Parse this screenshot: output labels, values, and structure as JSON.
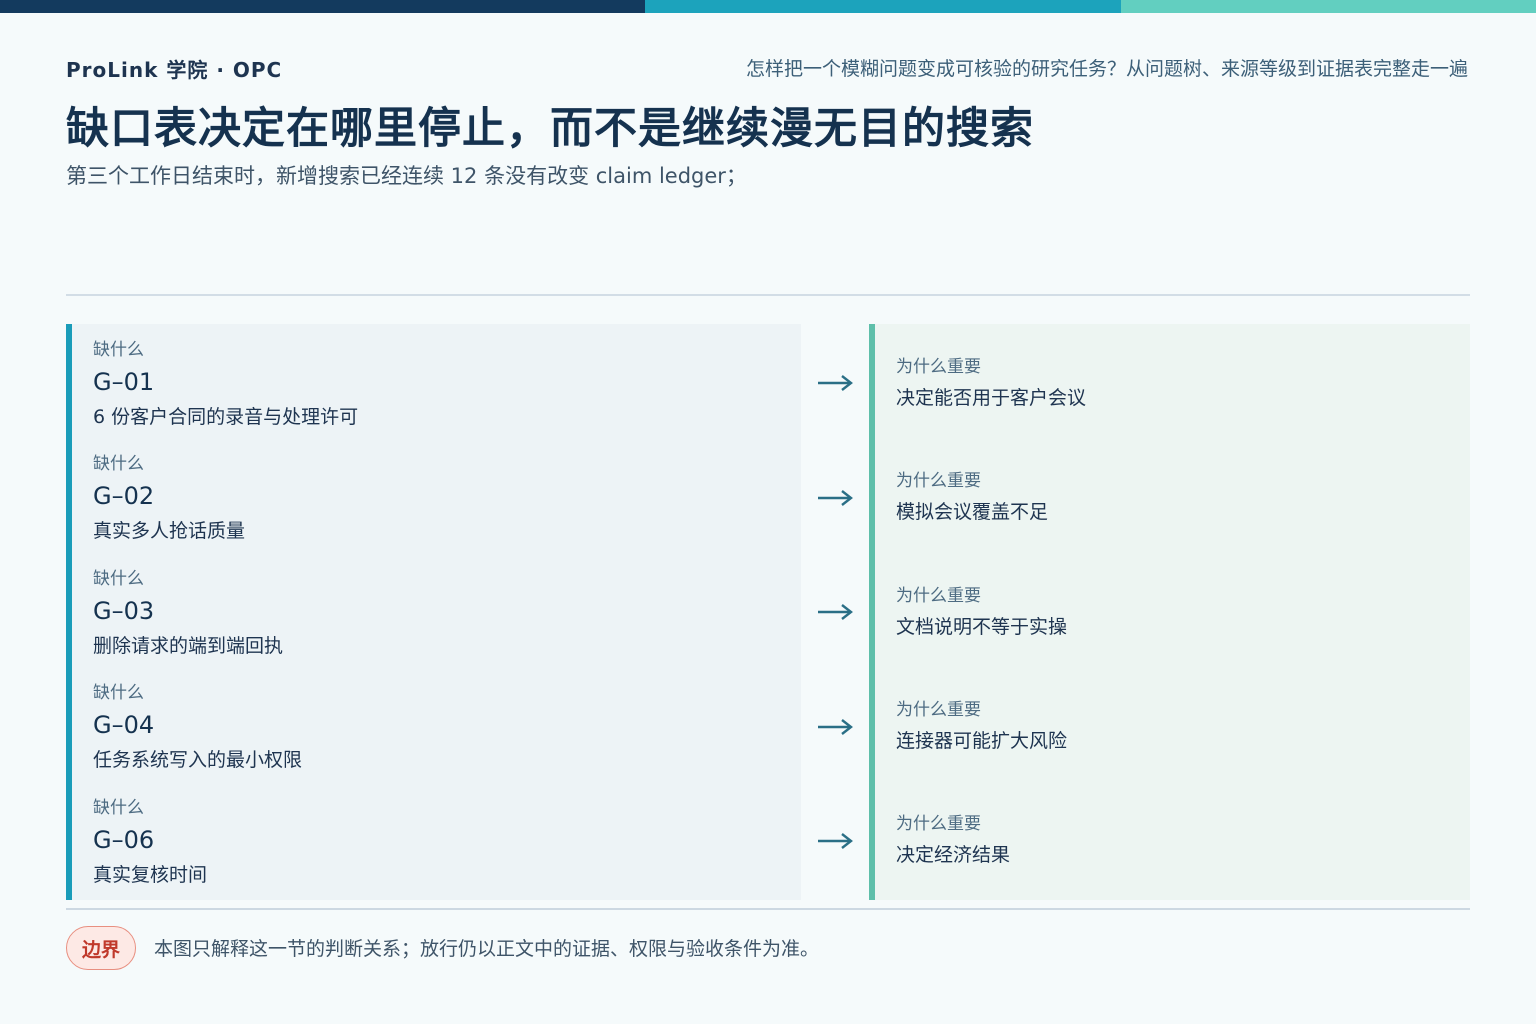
{
  "header": {
    "brand": "ProLink 学院 · OPC",
    "tagline": "怎样把一个模糊问题变成可核验的研究任务？从问题树、来源等级到证据表完整走一遍",
    "title": "缺口表决定在哪里停止，而不是继续漫无目的搜索",
    "subtitle": "第三个工作日结束时，新增搜索已经连续 12 条没有改变 claim ledger；"
  },
  "gaps": [
    {
      "label": "缺什么",
      "code": "G–01",
      "desc": "6 份客户合同的录音与处理许可"
    },
    {
      "label": "缺什么",
      "code": "G–02",
      "desc": "真实多人抢话质量"
    },
    {
      "label": "缺什么",
      "code": "G–03",
      "desc": "删除请求的端到端回执"
    },
    {
      "label": "缺什么",
      "code": "G–04",
      "desc": "任务系统写入的最小权限"
    },
    {
      "label": "缺什么",
      "code": "G–06",
      "desc": "真实复核时间"
    }
  ],
  "reasons": [
    {
      "label": "为什么重要",
      "desc": "决定能否用于客户会议"
    },
    {
      "label": "为什么重要",
      "desc": "模拟会议覆盖不足"
    },
    {
      "label": "为什么重要",
      "desc": "文档说明不等于实操"
    },
    {
      "label": "为什么重要",
      "desc": "连接器可能扩大风险"
    },
    {
      "label": "为什么重要",
      "desc": "决定经济结果"
    }
  ],
  "footer": {
    "badge": "边界",
    "note": "本图只解释这一节的判断关系；放行仍以正文中的证据、权限与验收条件为准。"
  },
  "colors": {
    "navy": "#133a5e",
    "teal": "#1ca3bc",
    "mint": "#62cfc0",
    "badge_red": "#c0392b"
  }
}
